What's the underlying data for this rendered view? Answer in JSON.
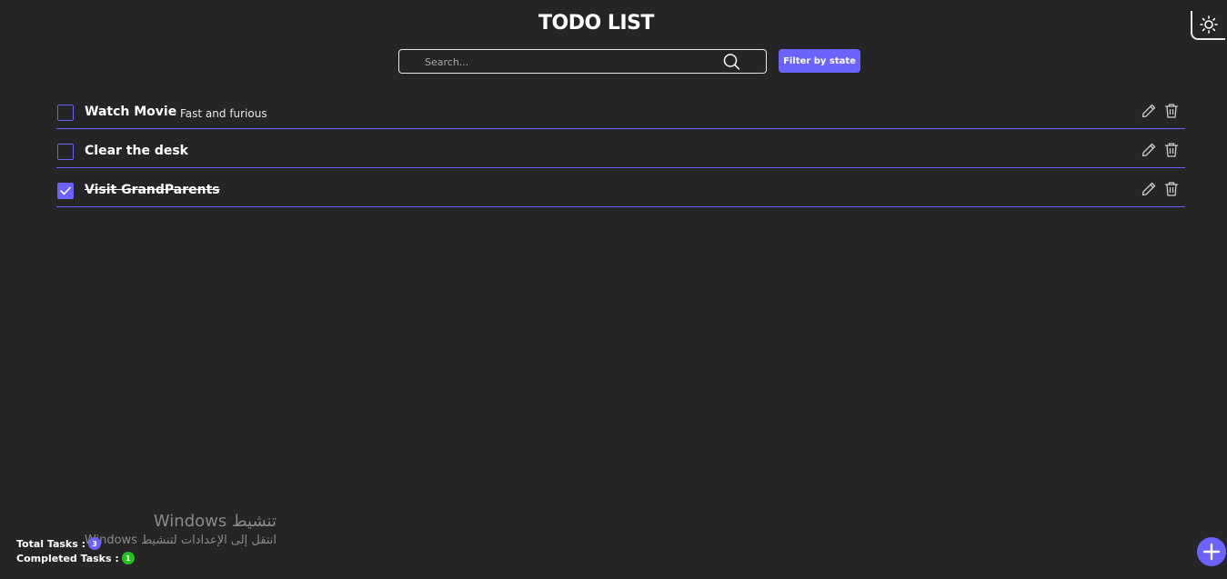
{
  "header": {
    "title": "TODO LIST",
    "theme_toggle_icon": "sun-icon"
  },
  "search": {
    "placeholder": "Search...",
    "value": "",
    "icon": "search-icon"
  },
  "filter": {
    "label": "Filter by state"
  },
  "tasks": [
    {
      "title": "Watch Movie",
      "description": "Fast and furious",
      "completed": false
    },
    {
      "title": "Clear the desk",
      "description": "",
      "completed": false
    },
    {
      "title": "Visit GrandParents",
      "description": "",
      "completed": true
    }
  ],
  "stats": {
    "total_label": "Total Tasks :",
    "total_value": "3",
    "completed_label": "Completed Tasks :",
    "completed_value": "1"
  },
  "windows_activation": {
    "line1": "تنشيط Windows",
    "line2": "انتقل إلى الإعدادات لتنشيط Windows"
  },
  "colors": {
    "background": "#252525",
    "accent": "#6c63ff",
    "completed_badge": "#21c11f"
  }
}
